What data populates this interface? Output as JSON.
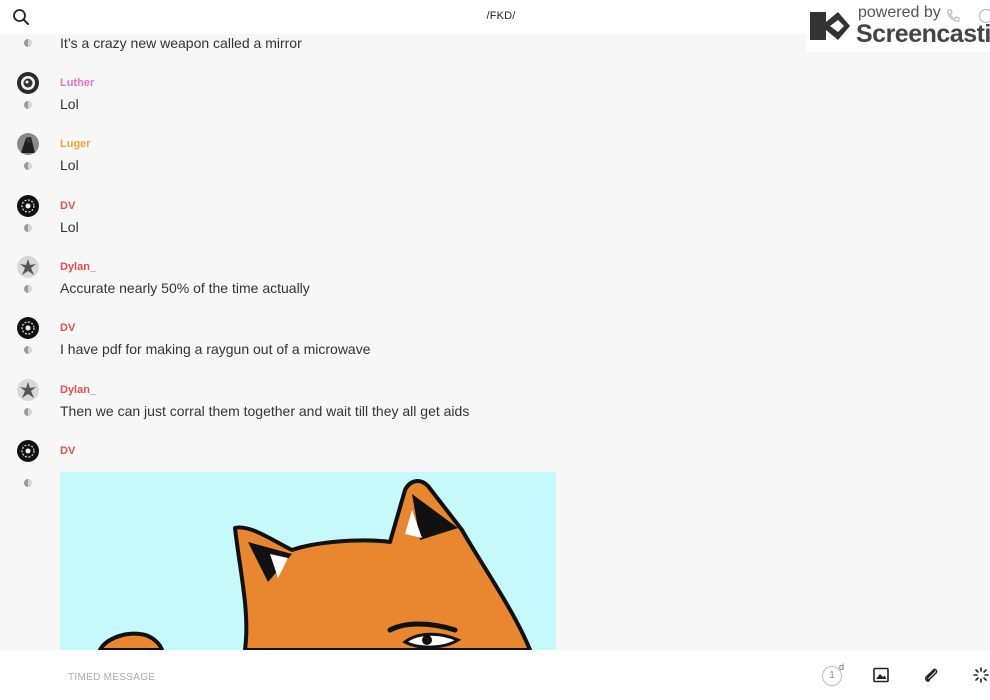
{
  "header": {
    "channel_title": "/FKD/"
  },
  "watermark": {
    "powered_by": "powered by",
    "brand": "Screencastify"
  },
  "messages": [
    {
      "username": "",
      "text": "It’s a crazy new weapon called a mirror",
      "name_color": ""
    },
    {
      "username": "Luther",
      "text": "Lol",
      "name_color": "#e273c5"
    },
    {
      "username": "Luger",
      "text": "Lol",
      "name_color": "#f0a43a"
    },
    {
      "username": "DV",
      "text": "Lol",
      "name_color": "#e05050"
    },
    {
      "username": "Dylan_",
      "text": "Accurate nearly 50% of the time actually",
      "name_color": "#e05050"
    },
    {
      "username": "DV",
      "text": "I have pdf for making a raygun out of a microwave",
      "name_color": "#e05050"
    },
    {
      "username": "Dylan_",
      "text": "Then we can just corral them together and wait till they all get aids",
      "name_color": "#e05050"
    },
    {
      "username": "DV",
      "text": "",
      "name_color": "#e05050"
    }
  ],
  "composer": {
    "placeholder": "TIMED MESSAGE",
    "timer_value": "1",
    "timer_unit": "d"
  },
  "icons": {
    "search": "search-icon",
    "image": "image-icon",
    "attach": "paperclip-icon",
    "loading": "spinner-icon"
  },
  "colors": {
    "background": "#f8f7f7",
    "image_bg": "#c5f9fb",
    "cat_orange": "#e8872f"
  }
}
